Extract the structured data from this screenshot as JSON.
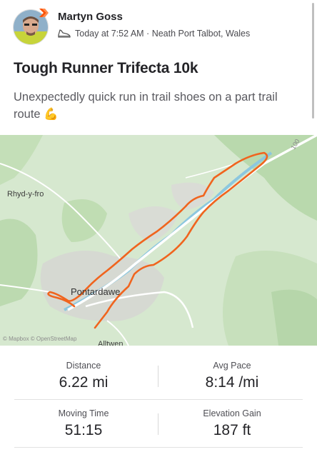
{
  "athlete": {
    "name": "Martyn Goss"
  },
  "activity": {
    "meta": "Today at 7:52 AM · Neath Port Talbot, Wales",
    "title": "Tough Runner Trifecta 10k",
    "description": "Unexpectedly quick run in trail shoes on a part trail route 💪"
  },
  "map": {
    "labels": {
      "rhyd": "Rhyd-y-fro",
      "pontardawe": "Pontardawe",
      "alltwen": "Alltwen",
      "road_number": "100"
    },
    "attribution": "© Mapbox © OpenStreetMap",
    "route_color": "#f0641e"
  },
  "stats": [
    {
      "label": "Distance",
      "value": "6.22 mi"
    },
    {
      "label": "Avg Pace",
      "value": "8:14 /mi"
    },
    {
      "label": "Moving Time",
      "value": "51:15"
    },
    {
      "label": "Elevation Gain",
      "value": "187 ft"
    }
  ],
  "colors": {
    "brand": "#fc5200",
    "background": "#ffffff"
  }
}
